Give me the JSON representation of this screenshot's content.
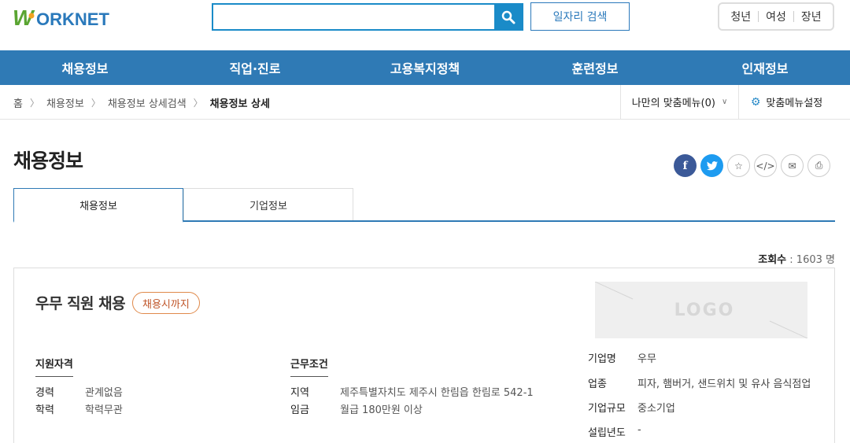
{
  "header": {
    "logo_text": "WORKNET",
    "search": {
      "value": "",
      "placeholder": ""
    },
    "job_search_label": "일자리 검색",
    "audience_links": [
      "청년",
      "여성",
      "장년"
    ]
  },
  "nav": [
    "채용정보",
    "직업·진로",
    "고용복지정책",
    "훈련정보",
    "인재정보"
  ],
  "breadcrumb": [
    "홈",
    "채용정보",
    "채용정보 상세검색",
    "채용정보 상세"
  ],
  "my_menu_label": "나만의 맞춤메뉴(0)",
  "menu_settings_label": "맞춤메뉴설정",
  "page_title": "채용정보",
  "share_icons": [
    "facebook-icon",
    "twitter-icon",
    "star-icon",
    "embed-code-icon",
    "email-icon",
    "print-icon"
  ],
  "tabs": [
    "채용정보",
    "기업정보"
  ],
  "views": {
    "label": "조회수",
    "value": "1603",
    "unit": "명"
  },
  "job": {
    "title": "우무 직원 채용",
    "deadline_badge": "채용시까지",
    "logo_placeholder": "LOGO",
    "qualification": {
      "heading": "지원자격",
      "rows": [
        {
          "k": "경력",
          "v": "관계없음"
        },
        {
          "k": "학력",
          "v": "학력무관"
        }
      ]
    },
    "conditions": {
      "heading": "근무조건",
      "rows": [
        {
          "k": "지역",
          "v": "제주특별자치도 제주시 한림읍 한림로 542-1"
        },
        {
          "k": "임금",
          "v": "월급 180만원 이상"
        }
      ]
    },
    "company": [
      {
        "k": "기업명",
        "v": "우무"
      },
      {
        "k": "업종",
        "v": "피자, 햄버거, 샌드위치 및 유사 음식점업"
      },
      {
        "k": "기업규모",
        "v": "중소기업"
      },
      {
        "k": "설립년도",
        "v": "-"
      }
    ]
  },
  "colors": {
    "brand_blue": "#2f7ab5",
    "search_blue": "#1a8bc8",
    "logo_green": "#5aa532",
    "badge_orange": "#e08a4b"
  }
}
